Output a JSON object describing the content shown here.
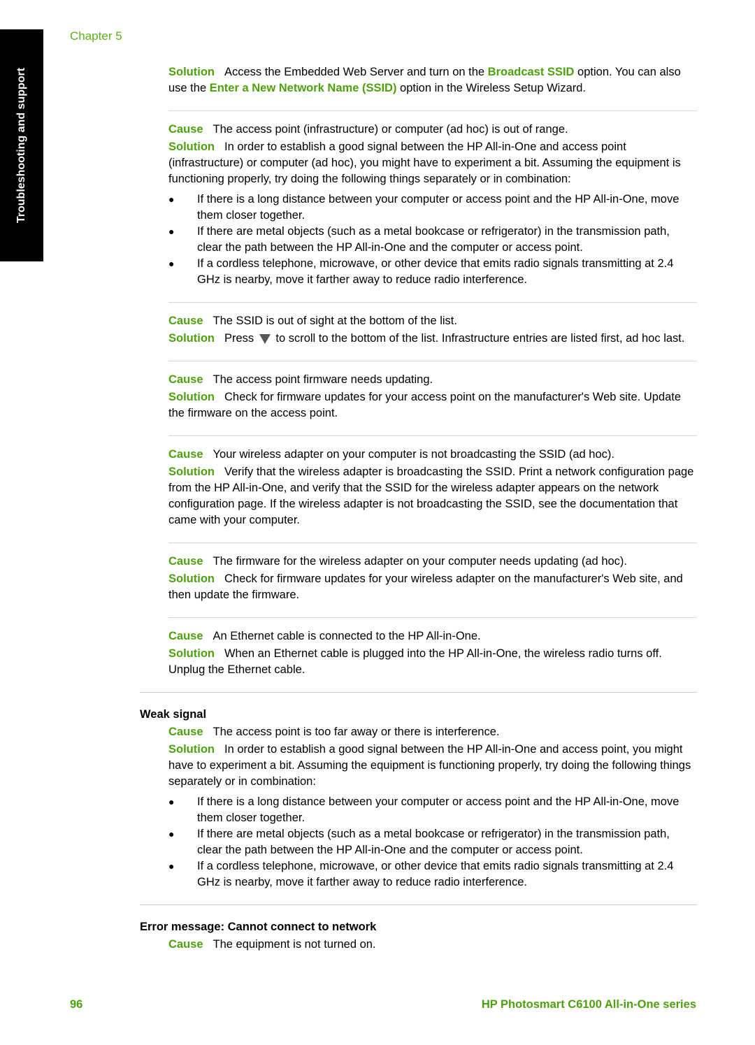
{
  "side_tab": "Troubleshooting and support",
  "chapter": "Chapter 5",
  "labels": {
    "cause": "Cause",
    "solution": "Solution"
  },
  "intro_solution": {
    "t1": "Access the Embedded Web Server and turn on the ",
    "k1": "Broadcast SSID",
    "t2": " option. You can also use the ",
    "k2": "Enter a New Network Name (SSID)",
    "t3": " option in the Wireless Setup Wizard."
  },
  "bullets_distance": [
    "If there is a long distance between your computer or access point and the HP All-in-One, move them closer together.",
    "If there are metal objects (such as a metal bookcase or refrigerator) in the transmission path, clear the path between the HP All-in-One and the computer or access point.",
    "If a cordless telephone, microwave, or other device that emits radio signals transmitting at 2.4 GHz is nearby, move it farther away to reduce radio interference."
  ],
  "entries": [
    {
      "cause": "The access point (infrastructure) or computer (ad hoc) is out of range.",
      "solution": "In order to establish a good signal between the HP All-in-One and access point (infrastructure) or computer (ad hoc), you might have to experiment a bit. Assuming the equipment is functioning properly, try doing the following things separately or in combination:"
    },
    {
      "cause": "The SSID is out of sight at the bottom of the list.",
      "solution_pre": "Press",
      "solution_icon": "down-arrow-icon",
      "solution_post": "to scroll to the bottom of the list. Infrastructure entries are listed first, ad hoc last."
    },
    {
      "cause": "The access point firmware needs updating.",
      "solution": "Check for firmware updates for your access point on the manufacturer's Web site. Update the firmware on the access point."
    },
    {
      "cause": "Your wireless adapter on your computer is not broadcasting the SSID (ad hoc).",
      "solution": "Verify that the wireless adapter is broadcasting the SSID. Print a network configuration page from the HP All-in-One, and verify that the SSID for the wireless adapter appears on the network configuration page. If the wireless adapter is not broadcasting the SSID, see the documentation that came with your computer."
    },
    {
      "cause": "The firmware for the wireless adapter on your computer needs updating (ad hoc).",
      "solution": "Check for firmware updates for your wireless adapter on the manufacturer's Web site, and then update the firmware."
    },
    {
      "cause": "An Ethernet cable is connected to the HP All-in-One.",
      "solution": "When an Ethernet cable is plugged into the HP All-in-One, the wireless radio turns off. Unplug the Ethernet cable."
    }
  ],
  "weak_signal": {
    "heading": "Weak signal",
    "cause": "The access point is too far away or there is interference.",
    "solution": "In order to establish a good signal between the HP All-in-One and access point, you might have to experiment a bit. Assuming the equipment is functioning properly, try doing the following things separately or in combination:"
  },
  "error_section": {
    "heading": "Error message: Cannot connect to network",
    "cause": "The equipment is not turned on."
  },
  "footer": {
    "page_number": "96",
    "product": "HP Photosmart C6100 All-in-One series"
  }
}
